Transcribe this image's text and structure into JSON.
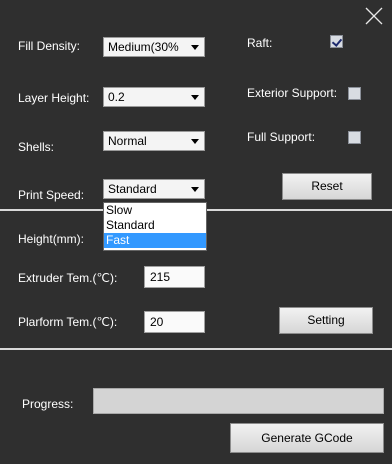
{
  "settings": {
    "fill_density_label": "Fill Density:",
    "fill_density_value": "Medium(30%",
    "layer_height_label": "Layer Height:",
    "layer_height_value": "0.2",
    "shells_label": "Shells:",
    "shells_value": "Normal",
    "print_speed_label": "Print Speed:",
    "print_speed_value": "Standard",
    "print_speed_options": [
      "Slow",
      "Standard",
      "Fast"
    ],
    "print_speed_highlighted": "Fast",
    "raft_label": "Raft:",
    "raft_checked": true,
    "exterior_support_label": "Exterior Support:",
    "exterior_support_checked": false,
    "full_support_label": "Full Support:",
    "full_support_checked": false,
    "reset_label": "Reset"
  },
  "temps": {
    "height_label": "Height(mm):",
    "extruder_label": "Extruder Tem.(℃):",
    "extruder_value": "215",
    "platform_label": "Plarform Tem.(℃):",
    "platform_value": "20",
    "setting_label": "Setting"
  },
  "footer": {
    "progress_label": "Progress:",
    "progress_fraction": 0,
    "generate_label": "Generate GCode"
  },
  "icons": {
    "close": "close-icon",
    "dropdown_arrow": "chevron-down-icon",
    "checkbox": "checkbox-icon"
  },
  "colors": {
    "background": "#2f2f2f",
    "highlight": "#3399ff",
    "divider": "#d9d9d9"
  }
}
